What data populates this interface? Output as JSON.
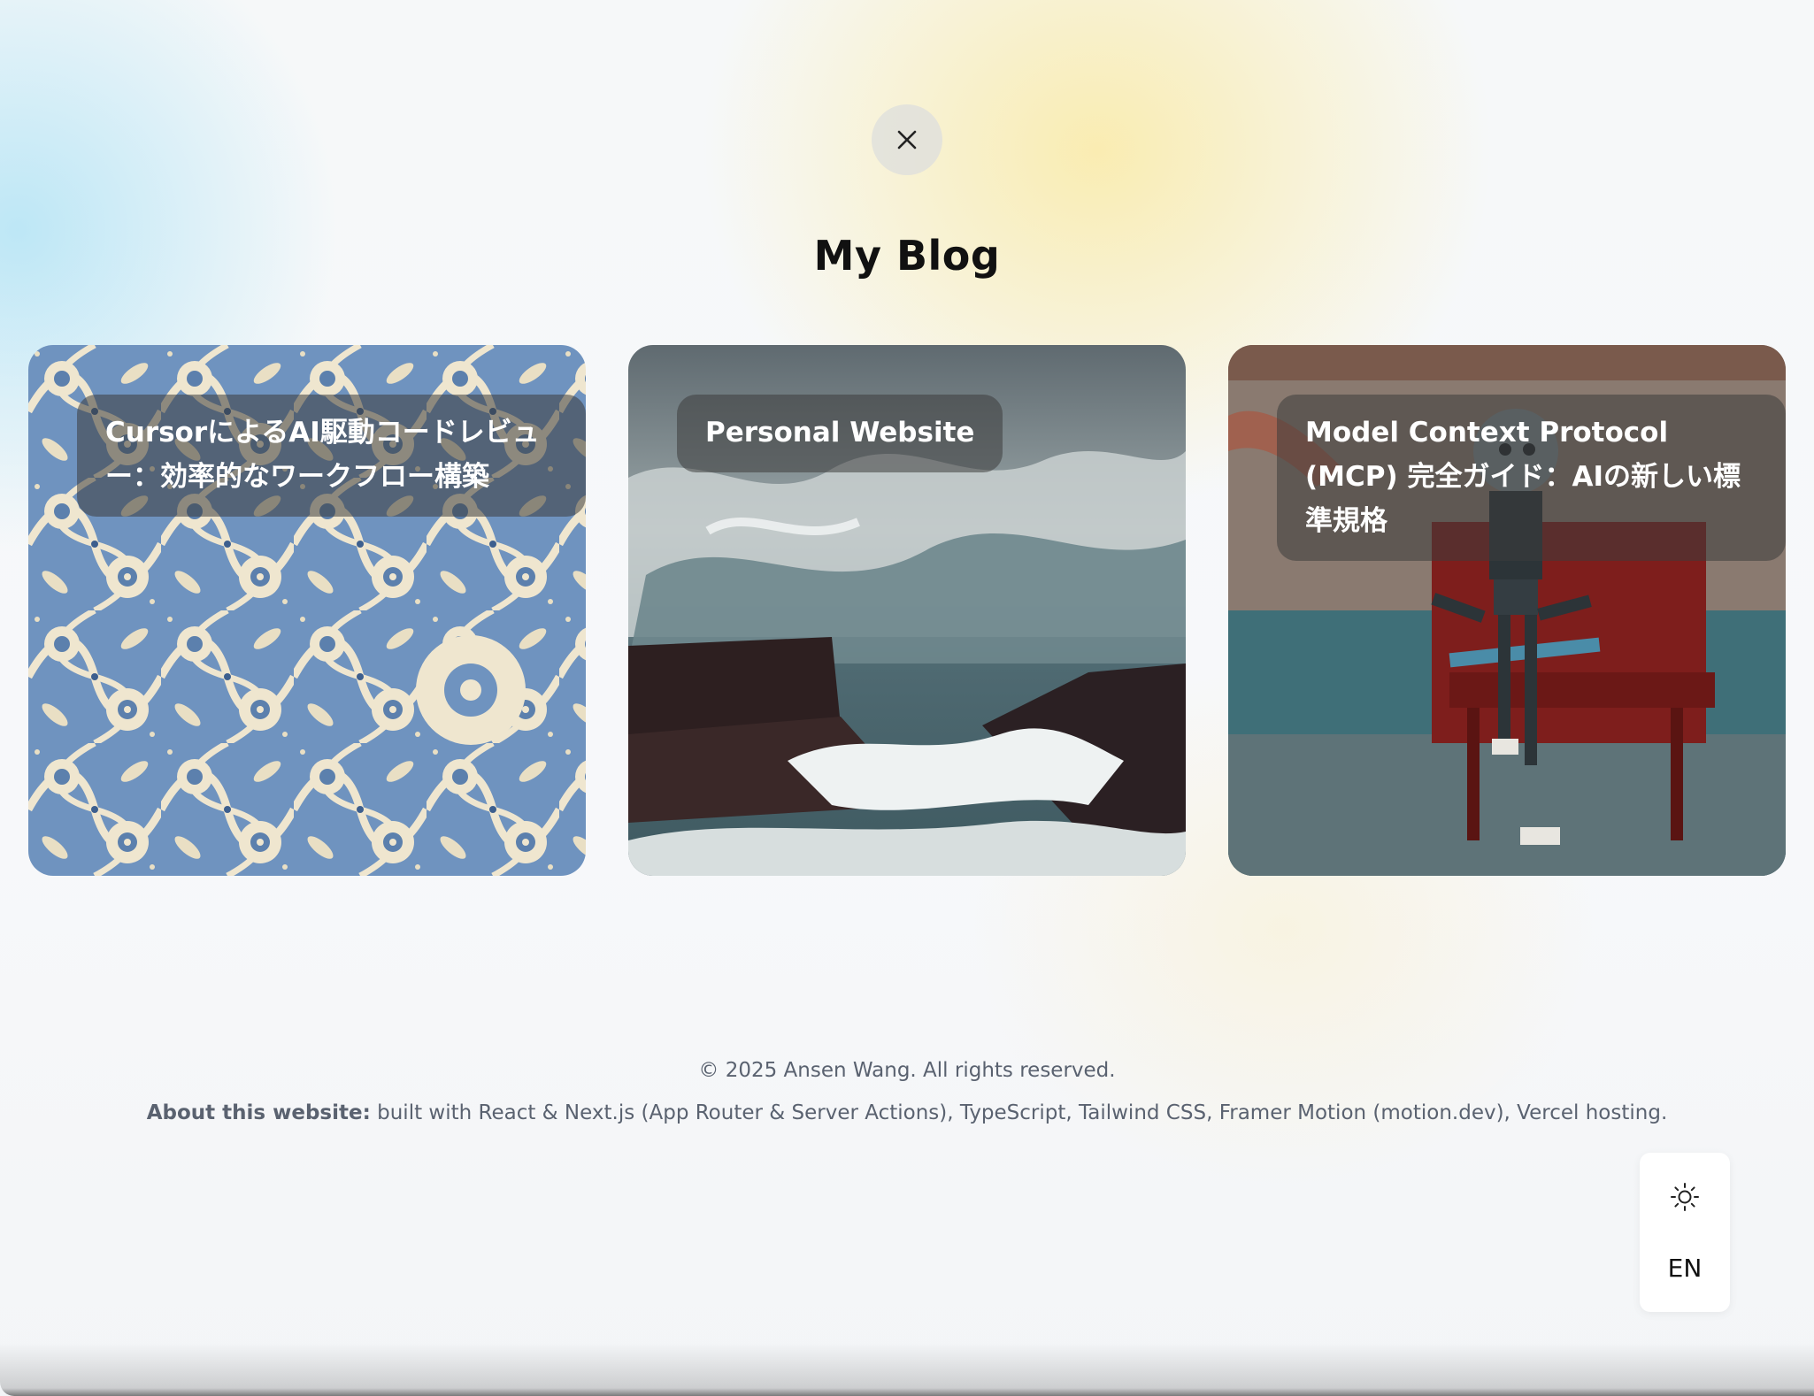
{
  "header": {
    "close_icon": "close-icon",
    "title": "My Blog"
  },
  "posts": [
    {
      "title": "CursorによるAI駆動コードレビュー：効率的なワークフロー構築",
      "image": "blue-floral-pattern"
    },
    {
      "title": "Personal Website",
      "image": "stormy-sea-painting"
    },
    {
      "title": "Model Context Protocol (MCP) 完全ガイド：AIの新しい標準規格",
      "image": "robot-on-bench"
    }
  ],
  "footer": {
    "copyright": "© 2025 Ansen Wang. All rights reserved.",
    "about_label": "About this website:",
    "about_text": " built with React & Next.js (App Router & Server Actions), TypeScript, Tailwind CSS, Framer Motion (motion.dev), Vercel hosting."
  },
  "controls": {
    "theme_icon": "sun-icon",
    "language": "EN"
  }
}
